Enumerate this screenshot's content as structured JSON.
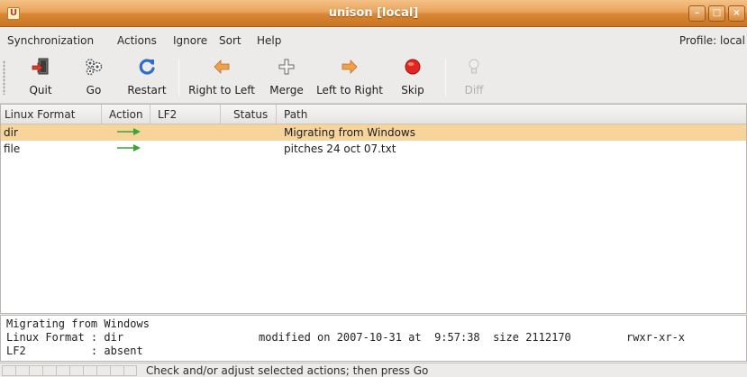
{
  "window": {
    "title": "unison [local]",
    "buttons": [
      "minimize",
      "maximize",
      "close"
    ]
  },
  "menubar": {
    "items": [
      "Synchronization",
      "Actions",
      "Ignore",
      "Sort",
      "Help"
    ],
    "profile": "Profile: local"
  },
  "toolbar": {
    "buttons": [
      {
        "label": "Quit",
        "icon": "quit-icon",
        "enabled": true
      },
      {
        "label": "Go",
        "icon": "go-gears-icon",
        "enabled": true
      },
      {
        "label": "Restart",
        "icon": "restart-icon",
        "enabled": true
      },
      {
        "label": "Right to Left",
        "icon": "arrow-left-icon",
        "enabled": true
      },
      {
        "label": "Merge",
        "icon": "merge-plus-icon",
        "enabled": true
      },
      {
        "label": "Left to Right",
        "icon": "arrow-right-icon",
        "enabled": true
      },
      {
        "label": "Skip",
        "icon": "skip-red-circle-icon",
        "enabled": true
      },
      {
        "label": "Diff",
        "icon": "diff-bulb-icon",
        "enabled": false
      }
    ]
  },
  "table": {
    "columns": [
      "Linux Format",
      "Action",
      "LF2",
      "Status",
      "Path"
    ],
    "rows": [
      {
        "linux_format": "dir",
        "action": "right-arrow",
        "lf2": "",
        "status": "",
        "path": "Migrating from Windows",
        "selected": true
      },
      {
        "linux_format": "file",
        "action": "right-arrow",
        "lf2": "",
        "status": "",
        "path": "pitches 24 oct 07.txt",
        "selected": false
      }
    ]
  },
  "details": {
    "heading": "Migrating from Windows",
    "line1_label": "Linux Format : dir",
    "line1_info": "modified on 2007-10-31 at  9:57:38  size 2112170",
    "line1_perms": "rwxr-xr-x",
    "line2_label": "LF2          : absent"
  },
  "statusbar": {
    "text": "Check and/or adjust selected actions; then press Go"
  },
  "colors": {
    "titlebar": "#d98733",
    "selection": "#f6d49c",
    "action_arrow": "#3aa53a"
  }
}
